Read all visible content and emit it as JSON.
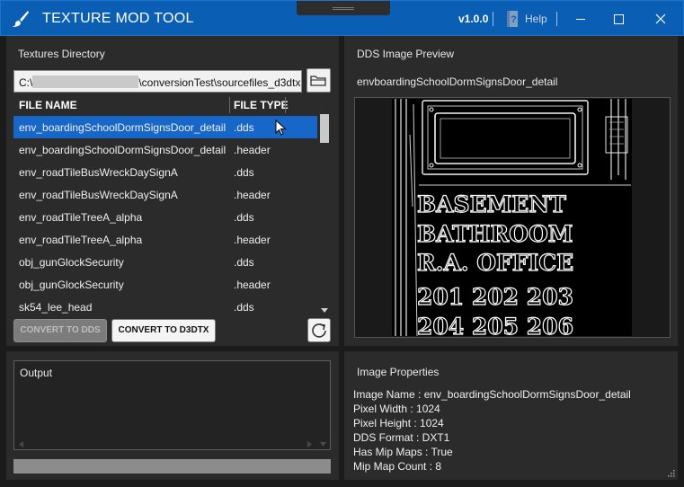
{
  "app": {
    "title": "TEXTURE MOD TOOL",
    "version": "v1.0.0",
    "help_label": "Help",
    "accent": "#0a5fb4"
  },
  "textures_panel": {
    "title": "Textures Directory",
    "path_prefix": "C:\\",
    "path_suffix": "\\conversionTest\\sourcefiles_d3dtx",
    "columns": [
      "FILE NAME",
      "FILE TYPE"
    ],
    "rows": [
      {
        "name": "env_boardingSchoolDormSignsDoor_detail",
        "type": ".dds",
        "selected": true
      },
      {
        "name": "env_boardingSchoolDormSignsDoor_detail",
        "type": ".header",
        "selected": false
      },
      {
        "name": "env_roadTileBusWreckDaySignA",
        "type": ".dds",
        "selected": false
      },
      {
        "name": "env_roadTileBusWreckDaySignA",
        "type": ".header",
        "selected": false
      },
      {
        "name": "env_roadTileTreeA_alpha",
        "type": ".dds",
        "selected": false
      },
      {
        "name": "env_roadTileTreeA_alpha",
        "type": ".header",
        "selected": false
      },
      {
        "name": "obj_gunGlockSecurity",
        "type": ".dds",
        "selected": false
      },
      {
        "name": "obj_gunGlockSecurity",
        "type": ".header",
        "selected": false
      },
      {
        "name": "sk54_lee_head",
        "type": ".dds",
        "selected": false
      }
    ],
    "convert_to_dds_label": "CONVERT TO DDS",
    "convert_to_d3dtx_label": "CONVERT TO D3DTX"
  },
  "preview_panel": {
    "title": "DDS Image Preview",
    "image_name": "envboardingSchoolDormSignsDoor_detail",
    "sign_lines": [
      "BASEMENT",
      "BATHROOM",
      "R.A. OFFICE",
      "201 202 203",
      "204 205 206"
    ]
  },
  "output_panel": {
    "title": "Output"
  },
  "properties_panel": {
    "title": "Image Properties",
    "lines": [
      "Image Name : env_boardingSchoolDormSignsDoor_detail",
      "Pixel Width : 1024",
      "Pixel Height : 1024",
      "DDS Format : DXT1",
      "Has Mip Maps : True",
      "Mip Map Count : 8"
    ]
  }
}
